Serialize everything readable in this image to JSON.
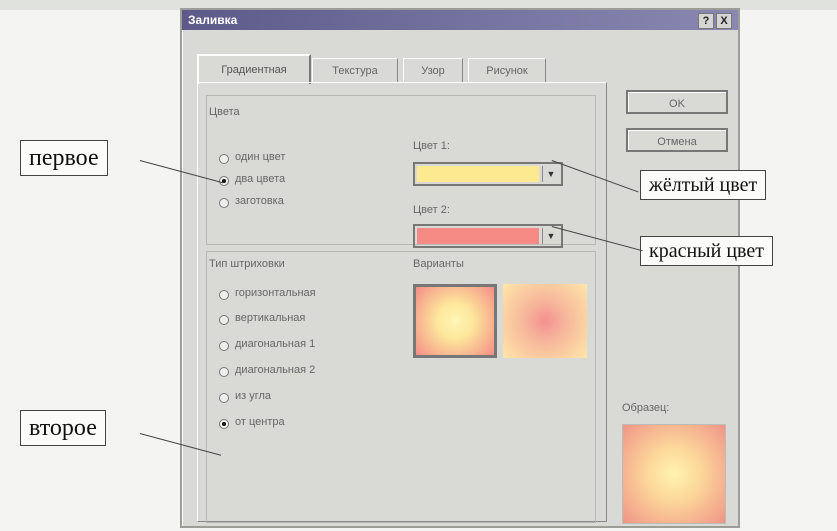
{
  "dialog": {
    "title": "Заливка",
    "help_button": "?",
    "close_button": "X",
    "tabs": [
      {
        "label": "Градиентная",
        "active": true
      },
      {
        "label": "Текстура",
        "active": false
      },
      {
        "label": "Узор",
        "active": false
      },
      {
        "label": "Рисунок",
        "active": false
      }
    ],
    "ok": "OK",
    "cancel": "Отмена",
    "colors_group": {
      "title": "Цвета",
      "options": [
        {
          "label": "один цвет",
          "selected": false
        },
        {
          "label": "два цвета",
          "selected": true
        },
        {
          "label": "заготовка",
          "selected": false
        }
      ],
      "color1_label": "Цвет 1:",
      "color1_value": "#fde98f",
      "color2_label": "Цвет 2:",
      "color2_value": "#f58b84"
    },
    "hatch_group": {
      "title": "Тип штриховки",
      "options": [
        {
          "label": "горизонтальная",
          "selected": false
        },
        {
          "label": "вертикальная",
          "selected": false
        },
        {
          "label": "диагональная 1",
          "selected": false
        },
        {
          "label": "диагональная 2",
          "selected": false
        },
        {
          "label": "из угла",
          "selected": false
        },
        {
          "label": "от центра",
          "selected": true
        }
      ]
    },
    "variants_label": "Варианты",
    "sample_label": "Образец:"
  },
  "annotations": {
    "first": "первое",
    "second": "второе",
    "yellow": "жёлтый цвет",
    "red": "красный цвет"
  },
  "colors": {
    "titlebar": "#5d5a8a",
    "yellow": "#fde98f",
    "red": "#f58b84"
  }
}
